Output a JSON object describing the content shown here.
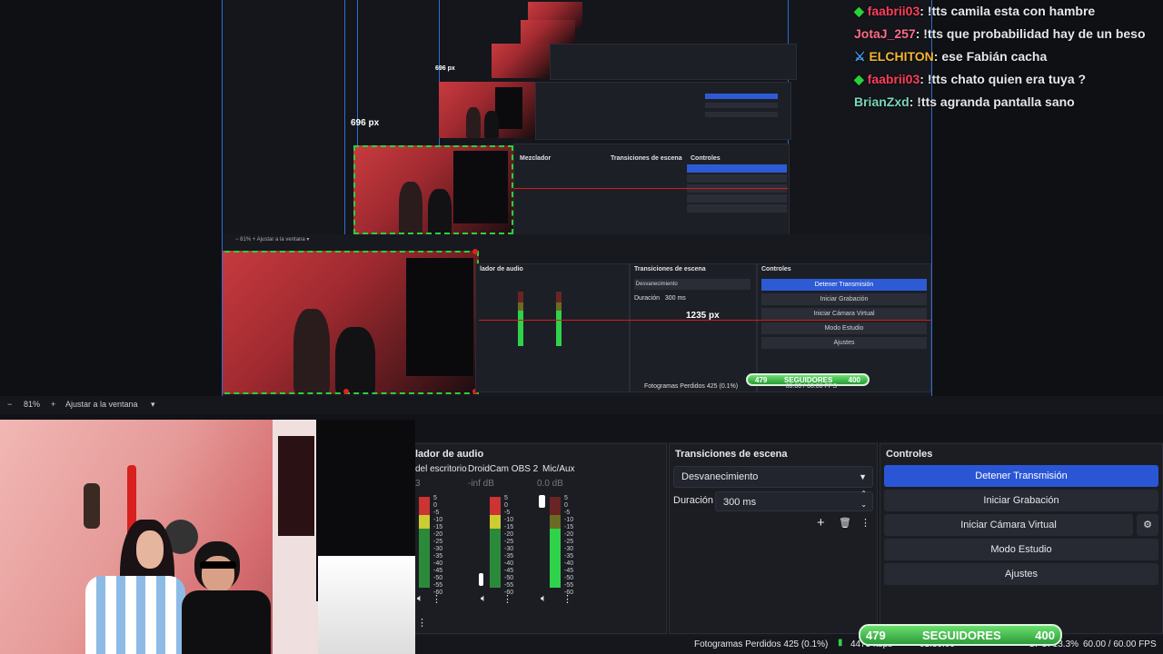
{
  "chat": [
    {
      "user": "faabrii03",
      "user_color": "#ff3e5a",
      "badge": "diamond",
      "message": ": !tts camila esta con hambre"
    },
    {
      "user": "JotaJ_257",
      "user_color": "#ff6b88",
      "badge": "",
      "message": ": !tts que probabilidad hay de un beso"
    },
    {
      "user": "ELCHITON",
      "user_color": "#f2b632",
      "badge": "mod",
      "message": ": ese Fabián cacha"
    },
    {
      "user": "faabrii03",
      "user_color": "#ff3e5a",
      "badge": "diamond",
      "message": ": !tts chato quien era tuya ?"
    },
    {
      "user": "BrianZxd",
      "user_color": "#7ad6b6",
      "badge": "",
      "message": ": !tts agranda pantalla sano"
    }
  ],
  "preview": {
    "px_label_1": "696 px",
    "px_label_2": "696 px",
    "px_label_3": "1235 px",
    "zoom": "81%",
    "fit_label": "Ajustar a la ventana"
  },
  "zoombar": {
    "minus": "−",
    "zoom": "81%",
    "plus": "+",
    "fit_label": "Ajustar a la ventana"
  },
  "audio": {
    "title": "lador de audio",
    "channels": [
      {
        "name": "del escritorio",
        "db": "3"
      },
      {
        "name": "DroidCam OBS 2",
        "db": "-inf dB"
      },
      {
        "name": "Mic/Aux",
        "db": "0.0 dB"
      }
    ],
    "scale": [
      "5",
      "0",
      "-5",
      "-10",
      "-15",
      "-20",
      "-25",
      "-30",
      "-35",
      "-40",
      "-45",
      "-50",
      "-55",
      "-60"
    ]
  },
  "transitions": {
    "title": "Transiciones de escena",
    "selected": "Desvanecimiento",
    "duration_label": "Duración",
    "duration_value": "300 ms"
  },
  "controls": {
    "title": "Controles",
    "buttons": [
      "Detener Transmisión",
      "Iniciar Grabación",
      "Iniciar Cámara Virtual",
      "Modo Estudio",
      "Ajustes"
    ]
  },
  "statusbar": {
    "dropped": "Fotogramas Perdidos 425 (0.1%)",
    "kbps": "4473 kbps",
    "time": "01:39:09",
    "cpu": "CPU: 13.3%",
    "fps": "60.00 / 60.00 FPS"
  },
  "followers": {
    "current": "479",
    "label": "SEGUIDORES",
    "goal": "400"
  },
  "colors": {
    "accent": "#2a56d6",
    "selection": "#27d33a",
    "guide": "#d51b1b"
  }
}
